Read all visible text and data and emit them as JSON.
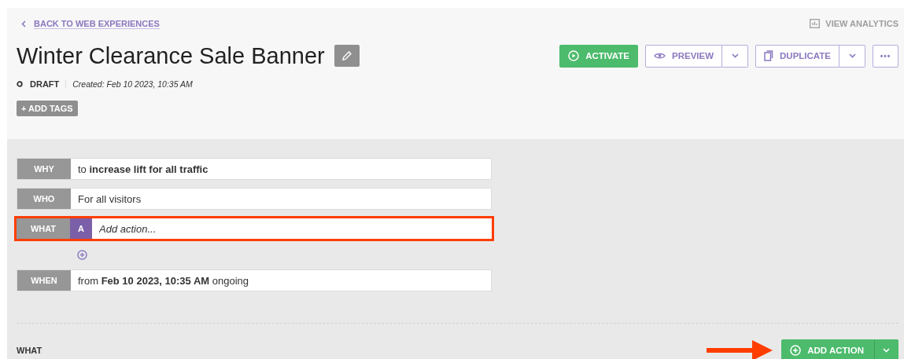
{
  "back_link": {
    "label": "BACK TO WEB EXPERIENCES"
  },
  "view_analytics": {
    "label": "VIEW ANALYTICS",
    "disabled": true
  },
  "title": "Winter Clearance Sale Banner",
  "actions": [
    {
      "kind": "primary",
      "label": "ACTIVATE"
    },
    {
      "kind": "split",
      "label": "PREVIEW"
    },
    {
      "kind": "split",
      "label": "DUPLICATE"
    },
    {
      "kind": "more",
      "label": "•••"
    }
  ],
  "status": {
    "label": "DRAFT",
    "created": "Created: Feb 10 2023, 10:35 AM"
  },
  "add_tags": "+ ADD TAGS",
  "rows": [
    {
      "kind": "text",
      "label": "WHY",
      "value": "to **increase lift for all traffic**",
      "highlighted": false
    },
    {
      "kind": "text",
      "label": "WHO",
      "value": "For all visitors",
      "highlighted": false
    },
    {
      "kind": "action",
      "label": "WHAT",
      "badge": "A",
      "placeholder": "Add action...",
      "highlighted": true
    },
    {
      "kind": "add"
    },
    {
      "kind": "text",
      "label": "WHEN",
      "value": "from **Feb 10 2023, 10:35 AM** ongoing",
      "highlighted": false
    }
  ],
  "footer": {
    "section": "WHAT",
    "button": "ADD ACTION",
    "pointer_arrow": true
  }
}
